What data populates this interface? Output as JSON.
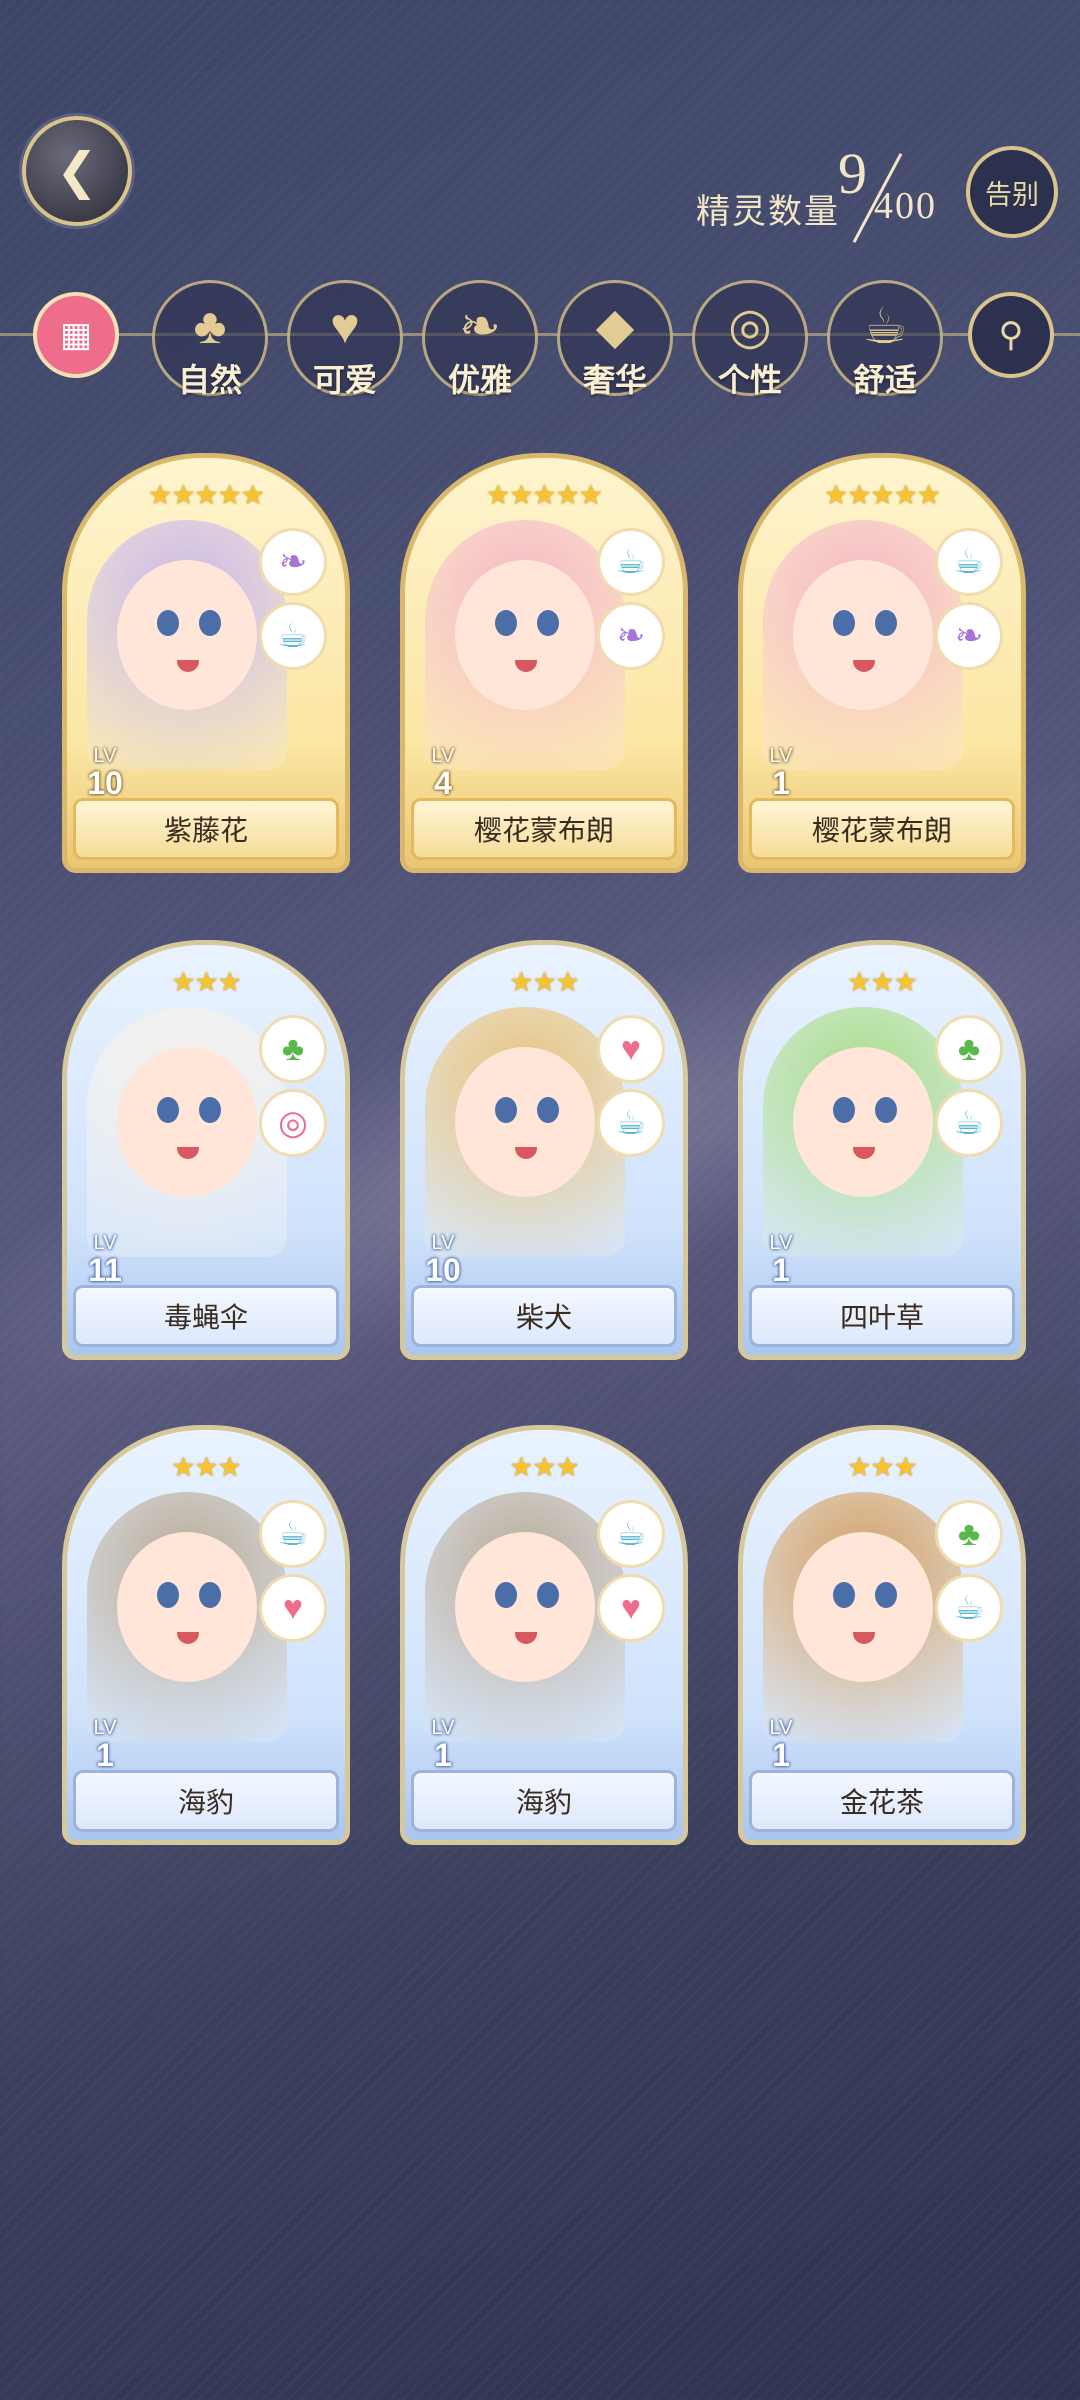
{
  "header": {
    "count_label": "精灵数量",
    "count_current": "9",
    "count_max": "400",
    "farewell_label": "告别"
  },
  "categories": [
    {
      "label": "自然",
      "icon": "clover-icon"
    },
    {
      "label": "可爱",
      "icon": "heart-icon"
    },
    {
      "label": "优雅",
      "icon": "swan-icon"
    },
    {
      "label": "奢华",
      "icon": "diamond-icon"
    },
    {
      "label": "个性",
      "icon": "glasses-icon"
    },
    {
      "label": "舒适",
      "icon": "teacup-icon"
    }
  ],
  "cards": [
    {
      "name": "紫藤花",
      "lv_label": "LV",
      "level": "10",
      "stars": "★★★★★",
      "rarity": "gold",
      "attrs": [
        "swan-icon",
        "teacup-icon"
      ],
      "accent": "#c9b8e8"
    },
    {
      "name": "樱花蒙布朗",
      "lv_label": "LV",
      "level": "4",
      "stars": "★★★★★",
      "rarity": "gold",
      "attrs": [
        "teacup-icon",
        "swan-icon"
      ],
      "accent": "#f5b8c4"
    },
    {
      "name": "樱花蒙布朗",
      "lv_label": "LV",
      "level": "1",
      "stars": "★★★★★",
      "rarity": "gold",
      "attrs": [
        "teacup-icon",
        "swan-icon"
      ],
      "accent": "#f5b8c4"
    },
    {
      "name": "毒蝇伞",
      "lv_label": "LV",
      "level": "11",
      "stars": "★★★",
      "rarity": "blue",
      "attrs": [
        "clover-icon",
        "glasses-icon"
      ],
      "accent": "#f4f0ea"
    },
    {
      "name": "柴犬",
      "lv_label": "LV",
      "level": "10",
      "stars": "★★★",
      "rarity": "blue",
      "attrs": [
        "heart-icon",
        "teacup-icon"
      ],
      "accent": "#e7c27a"
    },
    {
      "name": "四叶草",
      "lv_label": "LV",
      "level": "1",
      "stars": "★★★",
      "rarity": "blue",
      "attrs": [
        "clover-icon",
        "teacup-icon"
      ],
      "accent": "#a8dc86"
    },
    {
      "name": "海豹",
      "lv_label": "LV",
      "level": "1",
      "stars": "★★★",
      "rarity": "blue",
      "attrs": [
        "teacup-icon",
        "heart-icon"
      ],
      "accent": "#b8aa98"
    },
    {
      "name": "海豹",
      "lv_label": "LV",
      "level": "1",
      "stars": "★★★",
      "rarity": "blue",
      "attrs": [
        "teacup-icon",
        "heart-icon"
      ],
      "accent": "#b8aa98"
    },
    {
      "name": "金花茶",
      "lv_label": "LV",
      "level": "1",
      "stars": "★★★",
      "rarity": "blue",
      "attrs": [
        "clover-icon",
        "teacup-icon"
      ],
      "accent": "#d3a063"
    }
  ]
}
